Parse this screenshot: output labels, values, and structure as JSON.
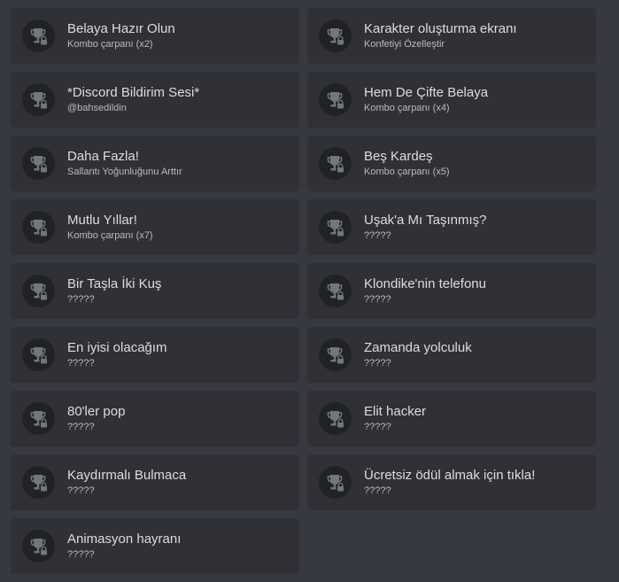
{
  "achievements": [
    {
      "title": "Belaya Hazır Olun",
      "subtitle": "Kombo çarpanı (x2)",
      "icon": "trophy-lock-icon"
    },
    {
      "title": "Karakter oluşturma ekranı",
      "subtitle": "Konfetiyi Özelleştir",
      "icon": "trophy-lock-icon"
    },
    {
      "title": "*Discord Bildirim Sesi*",
      "subtitle": "@bahsedildin",
      "icon": "trophy-lock-icon"
    },
    {
      "title": "Hem De Çifte Belaya",
      "subtitle": "Kombo çarpanı (x4)",
      "icon": "trophy-lock-icon"
    },
    {
      "title": "Daha Fazla!",
      "subtitle": "Sallantı Yoğunluğunu Arttır",
      "icon": "trophy-lock-icon"
    },
    {
      "title": "Beş Kardeş",
      "subtitle": "Kombo çarpanı (x5)",
      "icon": "trophy-lock-icon"
    },
    {
      "title": "Mutlu Yıllar!",
      "subtitle": "Kombo çarpanı (x7)",
      "icon": "trophy-lock-icon"
    },
    {
      "title": "Uşak'a Mı Taşınmış?",
      "subtitle": "?????",
      "icon": "trophy-lock-icon"
    },
    {
      "title": "Bir Taşla İki Kuş",
      "subtitle": "?????",
      "icon": "trophy-lock-icon"
    },
    {
      "title": "Klondike'nin telefonu",
      "subtitle": "?????",
      "icon": "trophy-lock-icon"
    },
    {
      "title": "En iyisi olacağım",
      "subtitle": "?????",
      "icon": "trophy-lock-icon"
    },
    {
      "title": "Zamanda yolculuk",
      "subtitle": "?????",
      "icon": "trophy-lock-icon"
    },
    {
      "title": "80'ler pop",
      "subtitle": "?????",
      "icon": "trophy-lock-icon"
    },
    {
      "title": "Elit hacker",
      "subtitle": "?????",
      "icon": "trophy-lock-icon"
    },
    {
      "title": "Kaydırmalı Bulmaca",
      "subtitle": "?????",
      "icon": "trophy-lock-icon"
    },
    {
      "title": "Ücretsiz ödül almak için tıkla!",
      "subtitle": "?????",
      "icon": "trophy-lock-icon"
    },
    {
      "title": "Animasyon hayranı",
      "subtitle": "?????",
      "icon": "trophy-lock-icon"
    }
  ],
  "colors": {
    "background": "#36393f",
    "card": "#2f3136",
    "icon_circle": "#202225",
    "icon_glyph": "#72767d",
    "title_text": "#dcddde",
    "subtitle_text": "#b9bbbe"
  }
}
